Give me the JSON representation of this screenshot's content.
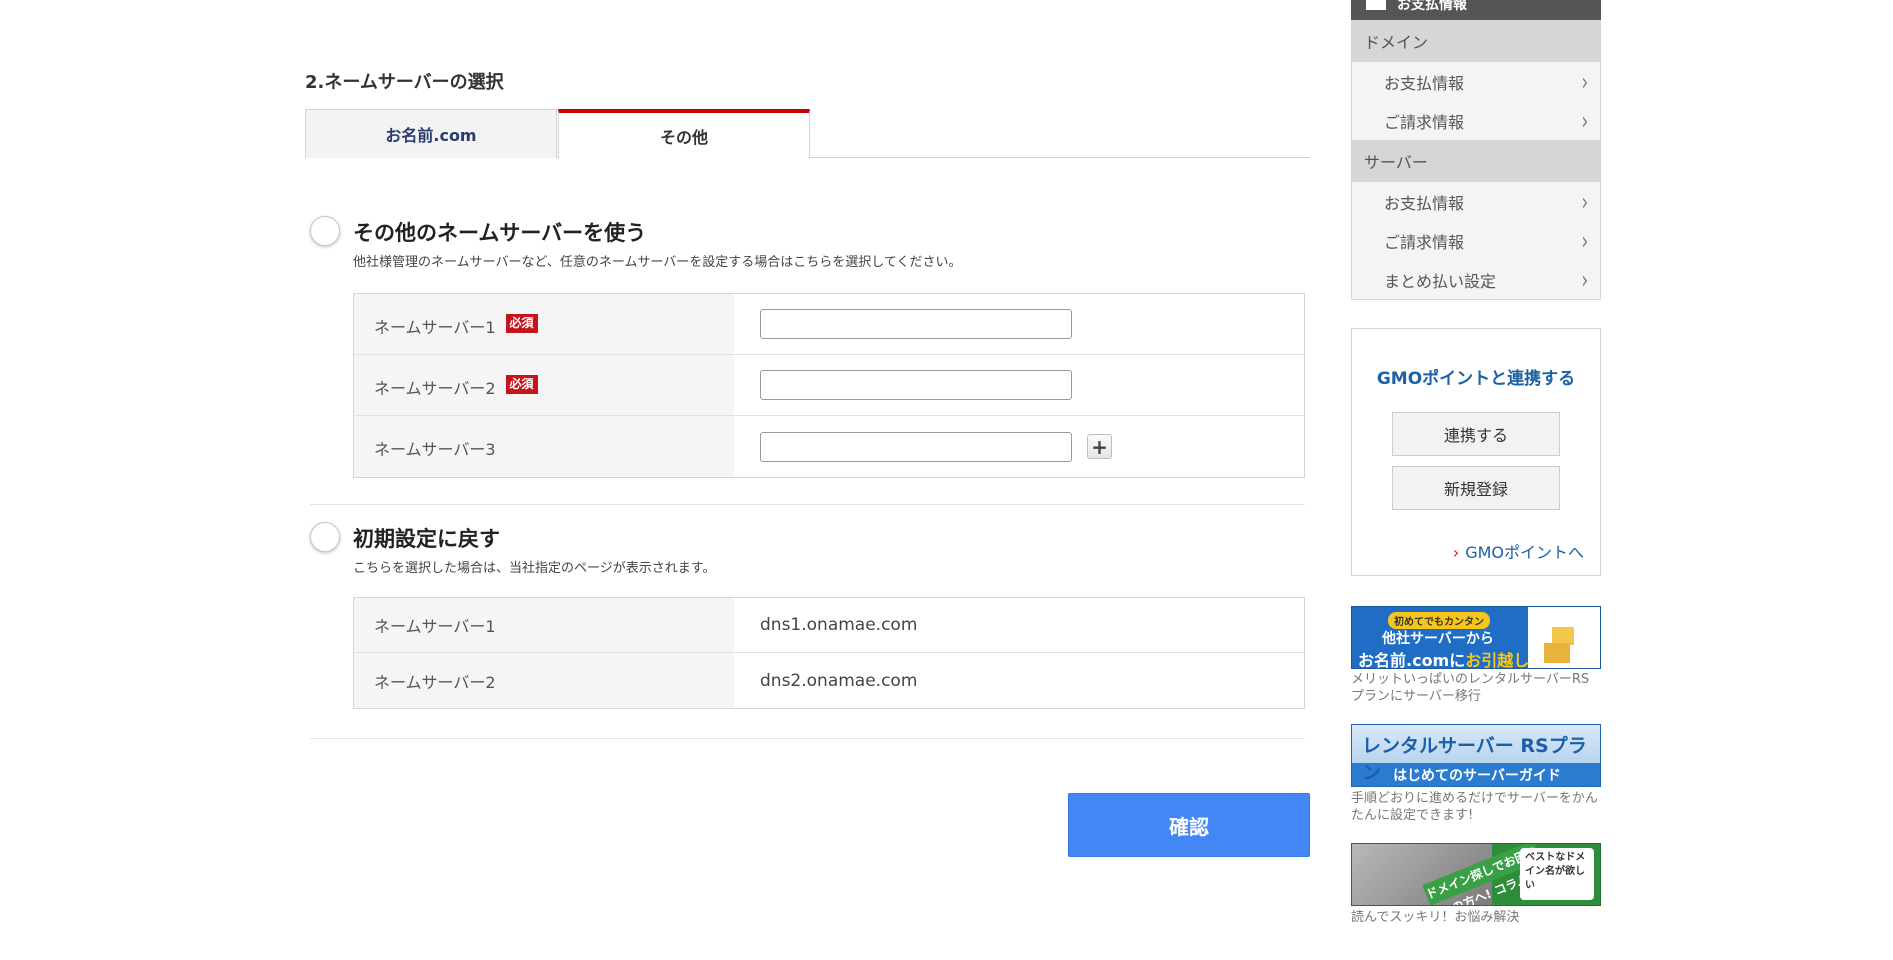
{
  "main": {
    "section_title": "2.ネームサーバーの選択",
    "tabs": [
      {
        "label": "お名前.com"
      },
      {
        "label": "その他"
      }
    ],
    "option_other": {
      "title": "その他のネームサーバーを使う",
      "description": "他社様管理のネームサーバーなど、任意のネームサーバーを設定する場合はこちらを選択してください。",
      "rows": [
        {
          "label": "ネームサーバー1",
          "badge": "必須",
          "value": ""
        },
        {
          "label": "ネームサーバー2",
          "badge": "必須",
          "value": ""
        },
        {
          "label": "ネームサーバー3",
          "value": ""
        }
      ],
      "add_icon": "plus-icon",
      "add_glyph": "+"
    },
    "option_default": {
      "title": "初期設定に戻す",
      "description": "こちらを選択した場合は、当社指定のページが表示されます。",
      "rows": [
        {
          "label": "ネームサーバー1",
          "value": "dns1.onamae.com"
        },
        {
          "label": "ネームサーバー2",
          "value": "dns2.onamae.com"
        }
      ]
    },
    "confirm_label": "確認"
  },
  "sidebar": {
    "header_label": "お支払情報",
    "groups": [
      {
        "category": "ドメイン",
        "items": [
          "お支払情報",
          "ご請求情報"
        ]
      },
      {
        "category": "サーバー",
        "items": [
          "お支払情報",
          "ご請求情報",
          "まとめ払い設定"
        ]
      }
    ],
    "chevron": "›",
    "gmo": {
      "title": "GMOポイントと連携する",
      "link_button": "連携する",
      "register_button": "新規登録",
      "link_text": "GMOポイントへ",
      "link_arrow": "›"
    },
    "banners": [
      {
        "tag": "初めてでもカンタン",
        "line1": "他社サーバーから",
        "line2_a": "お名前.comに",
        "line2_b": "お引越し",
        "caption": "メリットいっぱいのレンタルサーバーRSプランにサーバー移行"
      },
      {
        "line1": "レンタルサーバー RSプラン",
        "line2": "はじめてのサーバーガイド",
        "caption": "手順どおりに進めるだけでサーバーをかんたんに設定できます!"
      },
      {
        "stripe": "ドメイン探しでお困りの方へ! コラム",
        "bubble": "ベストなドメイン名が欲しい",
        "caption": "読んでスッキリ！お悩み解決"
      }
    ]
  },
  "colors": {
    "accent_red": "#cc0000",
    "confirm_blue": "#4287f5",
    "link_blue": "#1b62a8"
  }
}
